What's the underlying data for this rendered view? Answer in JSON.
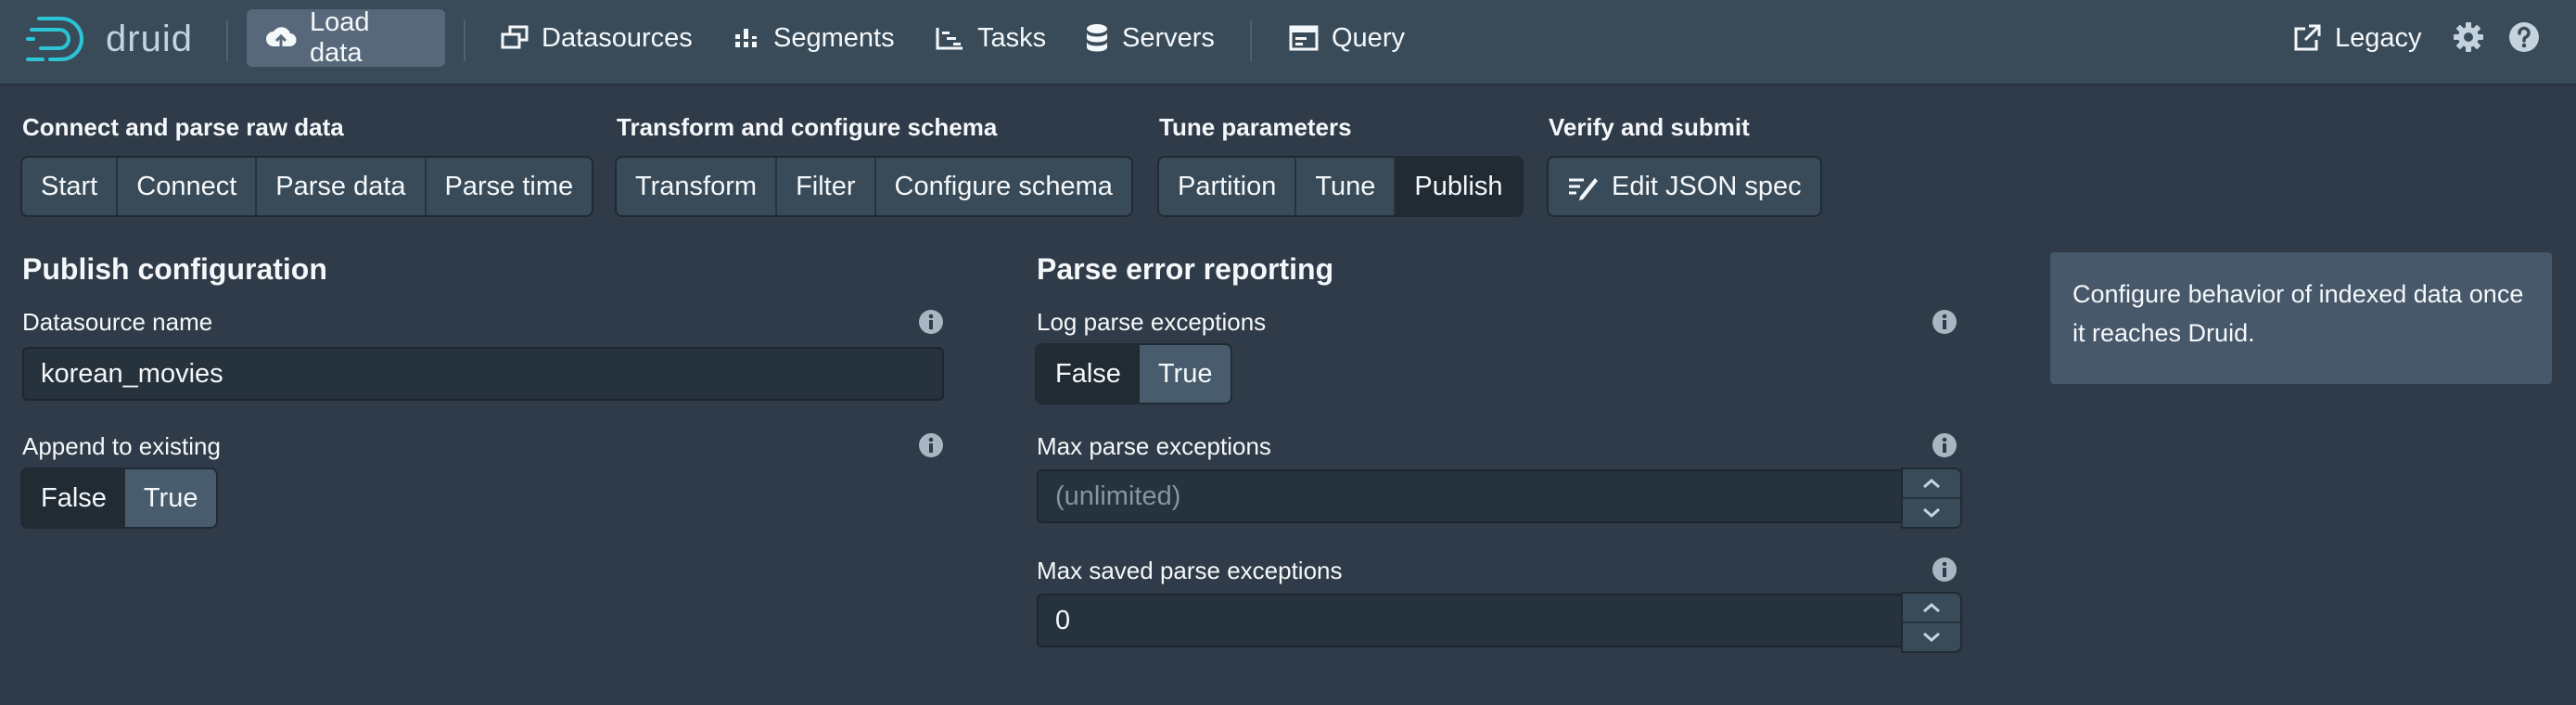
{
  "app": {
    "name": "druid"
  },
  "nav": {
    "load_data": "Load data",
    "datasources": "Datasources",
    "segments": "Segments",
    "tasks": "Tasks",
    "servers": "Servers",
    "query": "Query",
    "legacy": "Legacy"
  },
  "steps": {
    "connect_group": {
      "title": "Connect and parse raw data",
      "items": [
        "Start",
        "Connect",
        "Parse data",
        "Parse time"
      ]
    },
    "transform_group": {
      "title": "Transform and configure schema",
      "items": [
        "Transform",
        "Filter",
        "Configure schema"
      ]
    },
    "tune_group": {
      "title": "Tune parameters",
      "items": [
        "Partition",
        "Tune",
        "Publish"
      ],
      "selected": "Publish"
    },
    "verify_group": {
      "title": "Verify and submit",
      "edit_json": "Edit JSON spec"
    }
  },
  "publish": {
    "title": "Publish configuration",
    "datasource_label": "Datasource name",
    "datasource_value": "korean_movies",
    "append_label": "Append to existing",
    "append_false": "False",
    "append_true": "True",
    "append_selected": "False"
  },
  "parse_errors": {
    "title": "Parse error reporting",
    "log_label": "Log parse exceptions",
    "log_false": "False",
    "log_true": "True",
    "log_selected": "False",
    "max_label": "Max parse exceptions",
    "max_placeholder": "(unlimited)",
    "max_saved_label": "Max saved parse exceptions",
    "max_saved_value": "0"
  },
  "help": {
    "text": "Configure behavior of indexed data once it reaches Druid."
  },
  "colors": {
    "background": "#2f3b48",
    "navbar": "#394b59",
    "selected": "#202b33",
    "accent": "#56687a"
  }
}
